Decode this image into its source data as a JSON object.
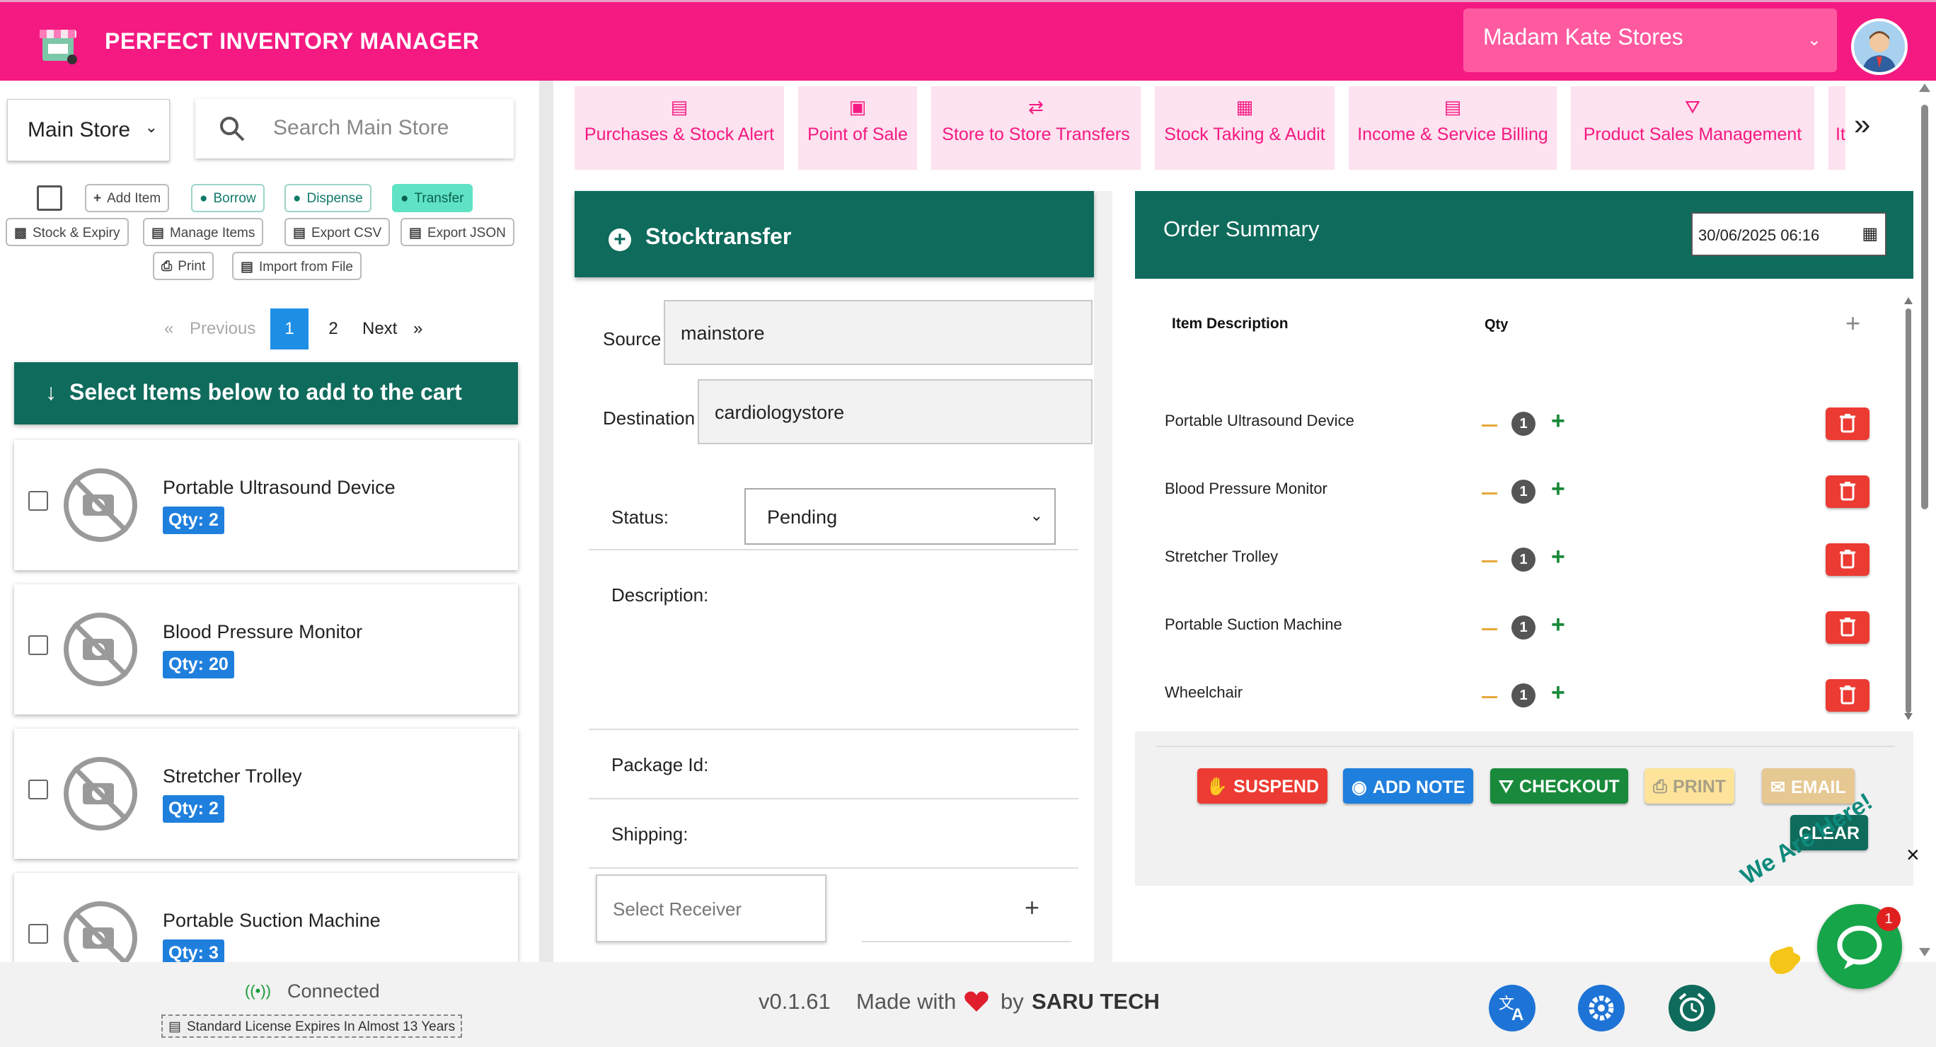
{
  "app": {
    "title": "PERFECT INVENTORY MANAGER",
    "store_name": "Madam Kate Stores"
  },
  "left": {
    "store_select": "Main Store",
    "search_placeholder": "Search  Main Store",
    "toolbar": {
      "add_item": "Add Item",
      "borrow": "Borrow",
      "dispense": "Dispense",
      "transfer": "Transfer",
      "stock_expiry": "Stock & Expiry",
      "manage_items": "Manage Items",
      "export_csv": "Export CSV",
      "export_json": "Export JSON",
      "print": "Print",
      "import_file": "Import from File"
    },
    "pager": {
      "prev_arrow": "«",
      "prev": "Previous",
      "pages": [
        "1",
        "2"
      ],
      "next": "Next",
      "next_arrow": "»",
      "current": "1"
    },
    "banner": "Select Items below to add to the cart",
    "items": [
      {
        "name": "Portable Ultrasound Device",
        "qty": "Qty: 2"
      },
      {
        "name": "Blood Pressure Monitor",
        "qty": "Qty: 20"
      },
      {
        "name": "Stretcher Trolley",
        "qty": "Qty: 2"
      },
      {
        "name": "Portable Suction Machine",
        "qty": "Qty: 3"
      }
    ]
  },
  "tabs": [
    {
      "label": "Purchases & Stock Alert",
      "icon": "invoice-icon"
    },
    {
      "label": "Point of Sale",
      "icon": "cash-register-icon"
    },
    {
      "label": "Store to Store Transfers",
      "icon": "exchange-icon"
    },
    {
      "label": "Stock Taking & Audit",
      "icon": "boxes-icon"
    },
    {
      "label": "Income & Service Billing",
      "icon": "receipt-icon"
    },
    {
      "label": "Product Sales Management",
      "icon": "cart-icon"
    },
    {
      "label": "It",
      "icon": ""
    }
  ],
  "tabs_more": "»",
  "transfer": {
    "title": "Stocktransfer",
    "source_label": "Source",
    "source_value": "mainstore",
    "destination_label": "Destination",
    "destination_value": "cardiologystore",
    "status_label": "Status:",
    "status_value": "Pending",
    "description_label": "Description:",
    "package_label": "Package Id:",
    "shipping_label": "Shipping:",
    "receiver_placeholder": "Select  Receiver",
    "receiver_add": "+"
  },
  "summary": {
    "title": "Order Summary",
    "date": "30/06/2025 06:16",
    "col_item": "Item Description",
    "col_qty": "Qty",
    "add": "+",
    "items": [
      {
        "name": "Portable Ultrasound Device",
        "qty": "1"
      },
      {
        "name": "Blood Pressure Monitor",
        "qty": "1"
      },
      {
        "name": "Stretcher Trolley",
        "qty": "1"
      },
      {
        "name": "Portable Suction Machine",
        "qty": "1"
      },
      {
        "name": "Wheelchair",
        "qty": "1"
      }
    ],
    "buttons": {
      "suspend": "SUSPEND",
      "add_note": "ADD NOTE",
      "checkout": "CHECKOUT",
      "print": "PRINT",
      "email": "EMAIL",
      "clear": "CLEAR"
    },
    "colors": {
      "suspend": "#ec3b33",
      "add_note": "#1f7fdd",
      "checkout": "#198a3c",
      "print": "#fde49a",
      "email": "#e6c892",
      "clear": "#0f6b5c"
    }
  },
  "footer": {
    "status": "Connected",
    "license": "Standard License Expires In Almost 13 Years",
    "version": "v0.1.61",
    "made_with": "Made with",
    "by": "by",
    "company": "SARU TECH"
  },
  "chat": {
    "tagline": "We Are Here!",
    "badge": "1",
    "close": "×"
  },
  "colors": {
    "brand": "#f51a82",
    "teal": "#0f6b5c",
    "tab_bg": "#fde2ef"
  }
}
